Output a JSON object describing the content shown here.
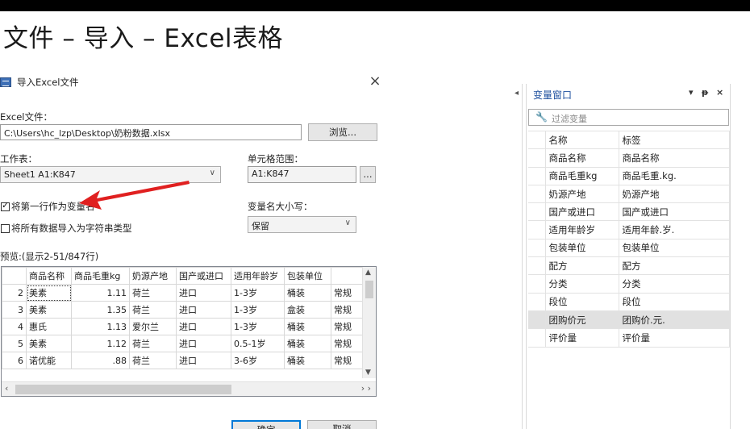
{
  "slide_title": "文件 – 导入 – Excel表格",
  "dialog": {
    "title": "导入Excel文件",
    "excel_file_label": "Excel文件：",
    "file_path": "C:\\Users\\hc_lzp\\Desktop\\奶粉数据.xlsx",
    "browse_label": "浏览...",
    "sheet_label": "工作表：",
    "sheet_value": "Sheet1 A1:K847",
    "range_label": "单元格范围：",
    "range_value": "A1:K847",
    "range_btn": "...",
    "first_row_label": "将第一行作为变量名",
    "first_row_checked": true,
    "as_string_label": "将所有数据导入为字符串类型",
    "as_string_checked": false,
    "case_label": "变量名大小写：",
    "case_value": "保留",
    "preview_label": "预览:(显示2-51/847行)",
    "columns": [
      "商品名称",
      "商品毛重kg",
      "奶源产地",
      "国产或进口",
      "适用年龄岁",
      "包装单位",
      ""
    ],
    "rows": [
      {
        "n": "2",
        "cells": [
          "美素",
          "1.11",
          "荷兰",
          "进口",
          "1-3岁",
          "桶装",
          "常规"
        ]
      },
      {
        "n": "3",
        "cells": [
          "美素",
          "1.35",
          "荷兰",
          "进口",
          "1-3岁",
          "盒装",
          "常规"
        ]
      },
      {
        "n": "4",
        "cells": [
          "惠氏",
          "1.13",
          "爱尔兰",
          "进口",
          "1-3岁",
          "桶装",
          "常规"
        ]
      },
      {
        "n": "5",
        "cells": [
          "美素",
          "1.12",
          "荷兰",
          "进口",
          "0.5-1岁",
          "桶装",
          "常规"
        ]
      },
      {
        "n": "6",
        "cells": [
          "诺优能",
          ".88",
          "荷兰",
          "进口",
          "3-6岁",
          "桶装",
          "常规"
        ]
      }
    ],
    "ok_label": "确定",
    "cancel_label": "取消"
  },
  "var_window": {
    "title": "变量窗口",
    "filter_placeholder": "过滤变量",
    "header": {
      "name": "名称",
      "label": "标签"
    },
    "variables": [
      {
        "name": "商品名称",
        "label": "商品名称"
      },
      {
        "name": "商品毛重kg",
        "label": "商品毛重.kg."
      },
      {
        "name": "奶源产地",
        "label": "奶源产地"
      },
      {
        "name": "国产或进口",
        "label": "国产或进口"
      },
      {
        "name": "适用年龄岁",
        "label": "适用年龄.岁."
      },
      {
        "name": "包装单位",
        "label": "包装单位"
      },
      {
        "name": "配方",
        "label": "配方"
      },
      {
        "name": "分类",
        "label": "分类"
      },
      {
        "name": "段位",
        "label": "段位"
      },
      {
        "name": "团购价元",
        "label": "团购价.元."
      },
      {
        "name": "评价量",
        "label": "评价量"
      }
    ],
    "selected_index": 9
  },
  "colors": {
    "arrow": "#e02020",
    "title_blue": "#1d4f9e",
    "ok_border": "#0078d7"
  }
}
